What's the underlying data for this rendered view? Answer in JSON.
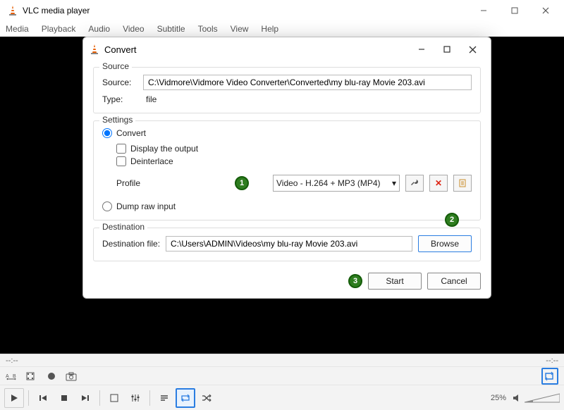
{
  "main": {
    "title": "VLC media player",
    "menu": [
      "Media",
      "Playback",
      "Audio",
      "Video",
      "Subtitle",
      "Tools",
      "View",
      "Help"
    ],
    "time_left": "--:--",
    "time_right": "--:--",
    "volume_pct": "25%"
  },
  "dialog": {
    "title": "Convert",
    "source": {
      "legend": "Source",
      "source_label": "Source:",
      "source_value": "C:\\Vidmore\\Vidmore Video Converter\\Converted\\my blu-ray Movie 203.avi",
      "type_label": "Type:",
      "type_value": "file"
    },
    "settings": {
      "legend": "Settings",
      "convert_label": "Convert",
      "display_output_label": "Display the output",
      "deinterlace_label": "Deinterlace",
      "profile_label": "Profile",
      "profile_value": "Video - H.264 + MP3 (MP4)",
      "dump_label": "Dump raw input"
    },
    "destination": {
      "legend": "Destination",
      "dest_label": "Destination file:",
      "dest_value": "C:\\Users\\ADMIN\\Videos\\my blu-ray Movie 203.avi",
      "browse": "Browse"
    },
    "buttons": {
      "start": "Start",
      "cancel": "Cancel"
    }
  },
  "badges": {
    "one": "1",
    "two": "2",
    "three": "3"
  }
}
